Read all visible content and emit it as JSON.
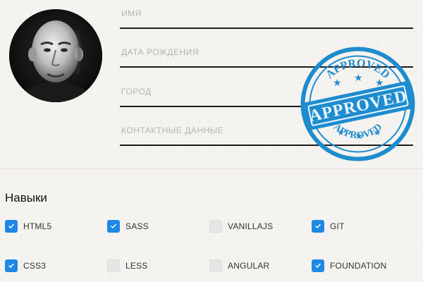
{
  "profile": {
    "fields": [
      {
        "label": "ИМЯ"
      },
      {
        "label": "ДАТА РОЖДЕНИЯ"
      },
      {
        "label": "ГОРОД"
      },
      {
        "label": "КОНТАКТНЫЕ ДАННЫЕ"
      }
    ]
  },
  "stamp": {
    "text": "APPROVED",
    "ring_text": "APPROVED",
    "color": "#1e8ccf"
  },
  "skills": {
    "title": "Навыки",
    "items": [
      {
        "label": "HTML5",
        "checked": true
      },
      {
        "label": "SASS",
        "checked": true
      },
      {
        "label": "VANILLAJS",
        "checked": false
      },
      {
        "label": "GIT",
        "checked": true
      },
      {
        "label": "CSS3",
        "checked": true
      },
      {
        "label": "LESS",
        "checked": false
      },
      {
        "label": "ANGULAR",
        "checked": false
      },
      {
        "label": "FOUNDATION",
        "checked": true
      }
    ]
  },
  "colors": {
    "accent": "#1e88e5",
    "unchecked": "#e6e6e6",
    "field_line": "#1b1b1b",
    "label": "#b3b3b3"
  }
}
